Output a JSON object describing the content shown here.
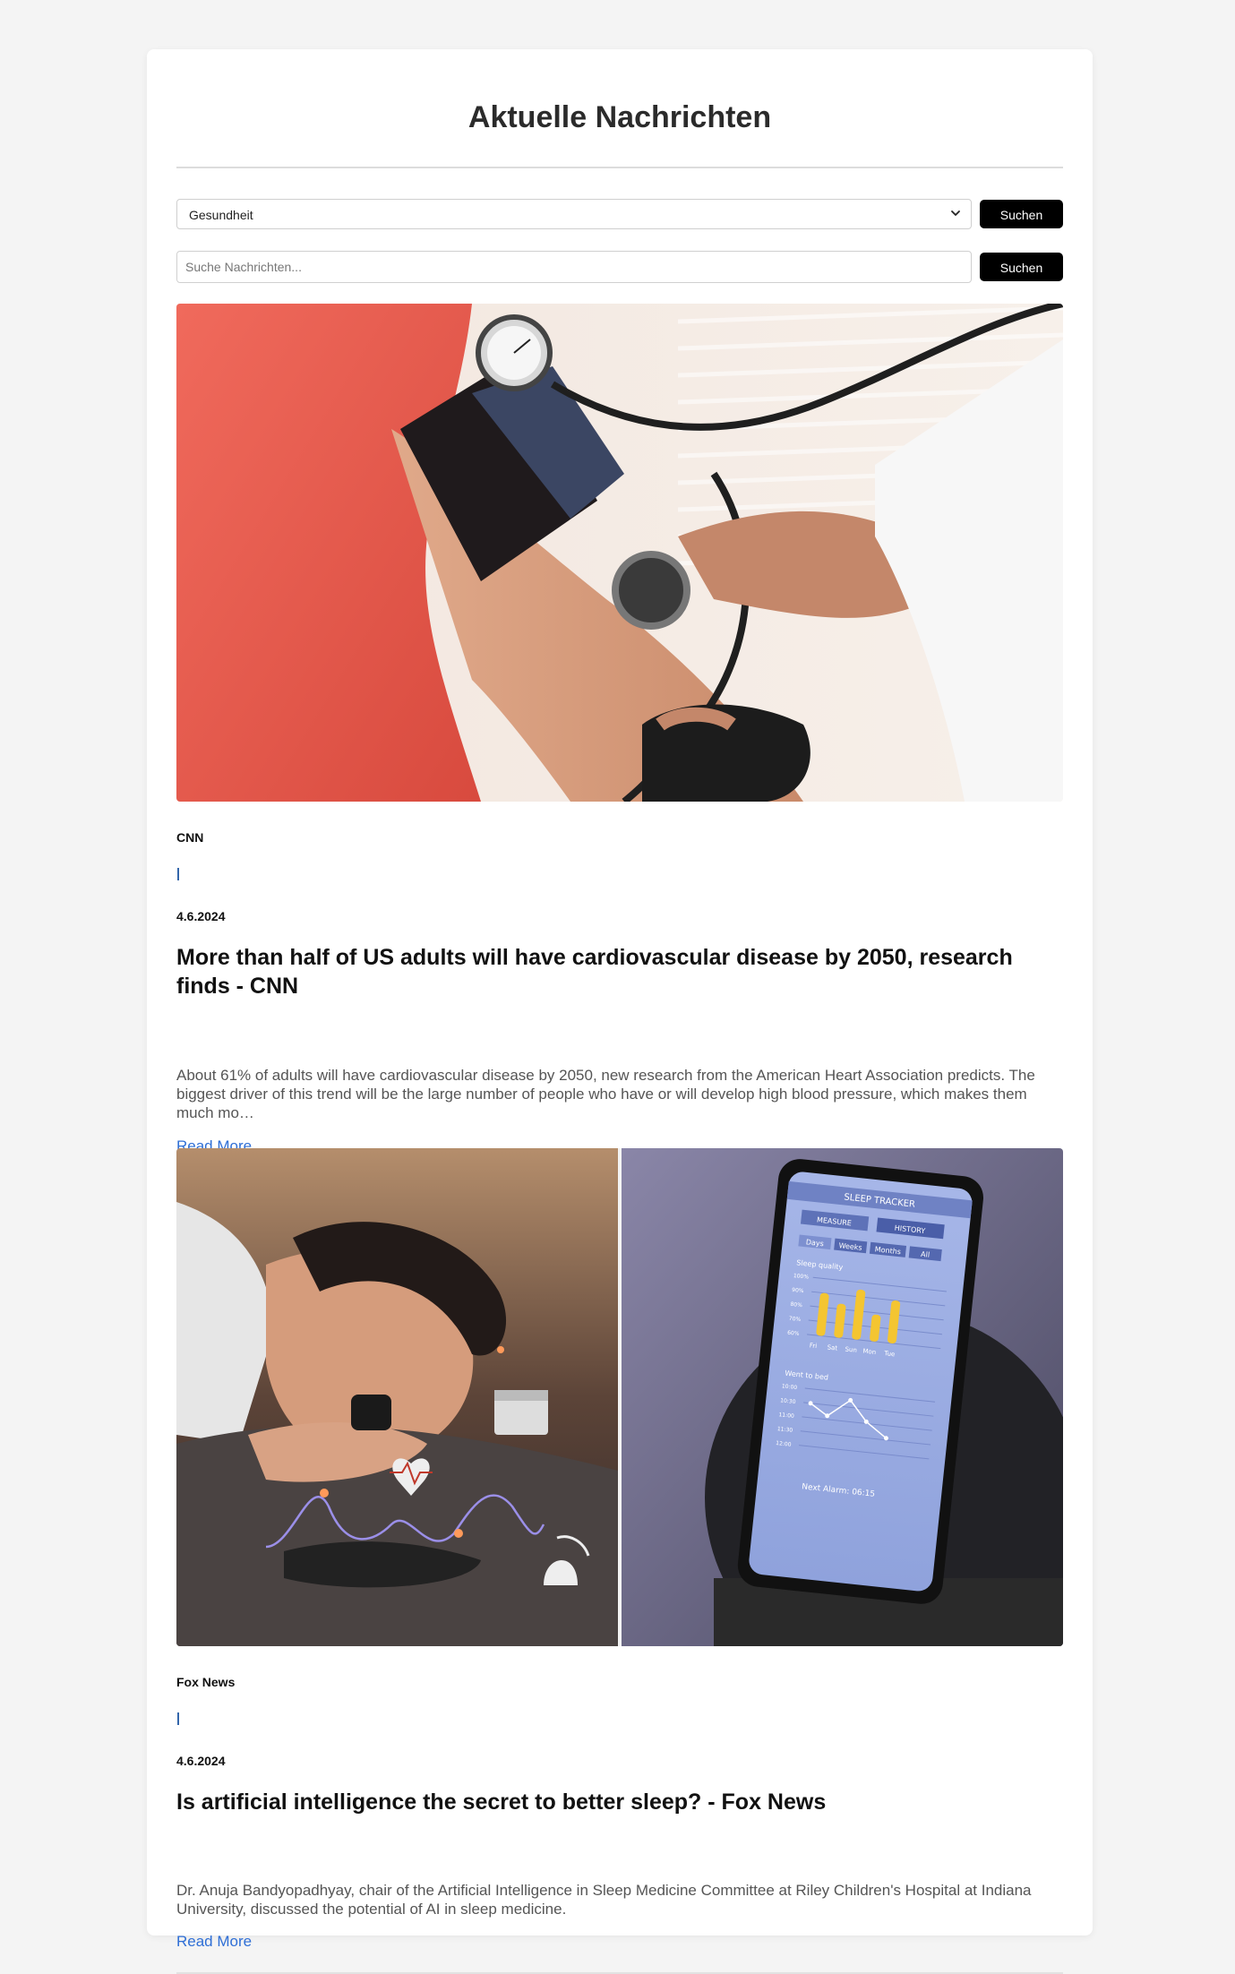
{
  "page": {
    "title": "Aktuelle Nachrichten"
  },
  "category_filter": {
    "selected": "Gesundheit",
    "button_label": "Suchen"
  },
  "search": {
    "placeholder": "Suche Nachrichten...",
    "value": "",
    "button_label": "Suchen"
  },
  "articles": [
    {
      "source": "CNN",
      "separator": "|",
      "date": "4.6.2024",
      "title": "More than half of US adults will have cardiovascular disease by 2050, research finds - CNN",
      "description": "About 61% of adults will have cardiovascular disease by 2050, new research from the American Heart Association predicts. The biggest driver of this trend will be the large number of people who have or will develop high blood pressure, which makes them much mo…",
      "read_more": "Read More",
      "image_icon": "blood-pressure-photo"
    },
    {
      "source": "Fox News",
      "separator": "|",
      "date": "4.6.2024",
      "title": "Is artificial intelligence the secret to better sleep? - Fox News",
      "description": "Dr. Anuja Bandyopadhyay, chair of the Artificial Intelligence in Sleep Medicine Committee at Riley Children's Hospital at Indiana University, discussed the potential of AI in sleep medicine.",
      "read_more": "Read More",
      "image_icon": "sleep-tracker-photo",
      "image_text": {
        "app_title": "SLEEP TRACKER",
        "tab_measure": "MEASURE",
        "tab_history": "HISTORY",
        "ranges": [
          "Days",
          "Weeks",
          "Months",
          "All"
        ],
        "quality_label": "Sleep quality",
        "quality_ticks": [
          "100%",
          "90%",
          "80%",
          "70%",
          "60%"
        ],
        "days": [
          "Fri",
          "Sat",
          "Sun",
          "Mon",
          "Tue"
        ],
        "bed_label": "Went to bed",
        "bed_ticks": [
          "10:00",
          "10:30",
          "11:00",
          "11:30",
          "12:00"
        ],
        "alarm": "Next Alarm: 06:15"
      }
    }
  ],
  "colors": {
    "accent_link": "#2f6fd6",
    "button_bg": "#000000",
    "title_text": "#2b2b2b"
  }
}
